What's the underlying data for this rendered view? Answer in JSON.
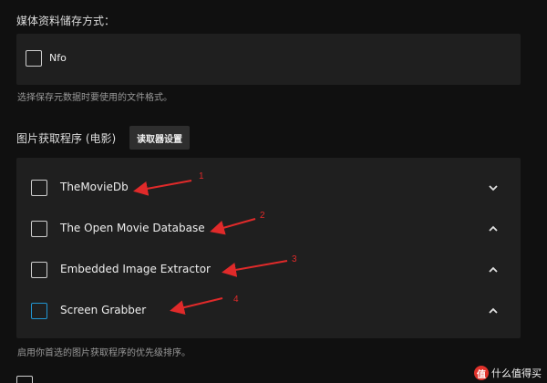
{
  "media_storage": {
    "heading": "媒体资料储存方式：",
    "nfo_label": "Nfo",
    "hint": "选择保存元数据时要使用的文件格式。"
  },
  "image_fetchers": {
    "heading": "图片获取程序 (电影)",
    "settings_button": "读取器设置",
    "items": [
      {
        "label": "TheMovieDb",
        "chevron": "down"
      },
      {
        "label": "The Open Movie Database",
        "chevron": "up"
      },
      {
        "label": "Embedded Image Extractor",
        "chevron": "up"
      },
      {
        "label": "Screen Grabber",
        "chevron": "up"
      }
    ],
    "hint": "启用你首选的图片获取程序的优先级排序。"
  },
  "annotations": [
    "1",
    "2",
    "3",
    "4"
  ],
  "watermark": {
    "logo": "值",
    "text": "什么值得买"
  },
  "colors": {
    "background": "#101010",
    "panel": "#1f1f1f",
    "arrow": "#e02a2a",
    "focus_checkbox": "#2196d3"
  }
}
